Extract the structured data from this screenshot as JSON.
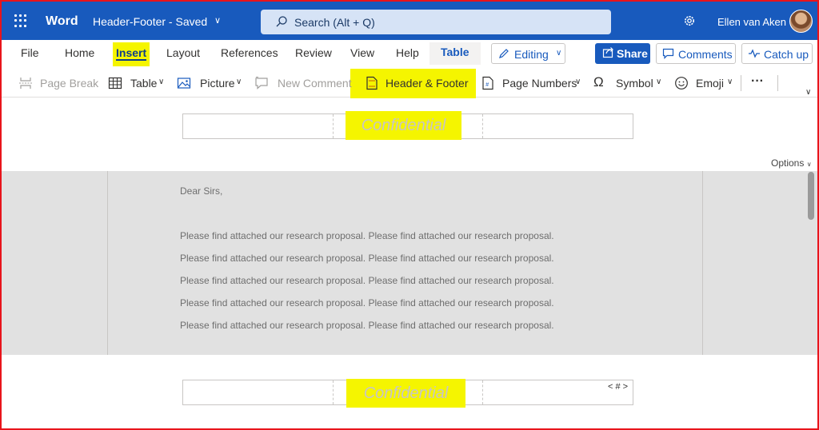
{
  "titlebar": {
    "app_name": "Word",
    "doc_name": "Header-Footer - Saved",
    "search_placeholder": "Search (Alt + Q)",
    "user_name": "Ellen van Aken"
  },
  "tabs": [
    {
      "label": "File"
    },
    {
      "label": "Home"
    },
    {
      "label": "Insert"
    },
    {
      "label": "Layout"
    },
    {
      "label": "References"
    },
    {
      "label": "Review"
    },
    {
      "label": "View"
    },
    {
      "label": "Help"
    },
    {
      "label": "Table"
    }
  ],
  "mode_button": {
    "label": "Editing"
  },
  "actions": {
    "share": "Share",
    "comments": "Comments",
    "catch_up": "Catch up"
  },
  "commands": {
    "page_break": "Page Break",
    "table": "Table",
    "picture": "Picture",
    "new_comment": "New Comment",
    "header_footer": "Header & Footer",
    "page_numbers": "Page Numbers",
    "symbol": "Symbol",
    "emoji": "Emoji",
    "more": "···"
  },
  "header": {
    "text": "Confidential"
  },
  "options_label": "Options",
  "body": {
    "salutation": "Dear Sirs,",
    "lines": [
      "Please find attached our research proposal. Please find attached our research proposal.",
      "Please find attached our research proposal. Please find attached our research proposal.",
      "Please find attached our research proposal. Please find attached our research proposal.",
      "Please find attached our research proposal. Please find attached our research proposal.",
      "Please find attached our research proposal. Please find attached our research proposal."
    ]
  },
  "footer": {
    "text": "Confidential",
    "page_number": "< # >"
  },
  "colors": {
    "brand": "#185abd",
    "highlight": "#f5f500",
    "frame_border": "#e8141b"
  }
}
